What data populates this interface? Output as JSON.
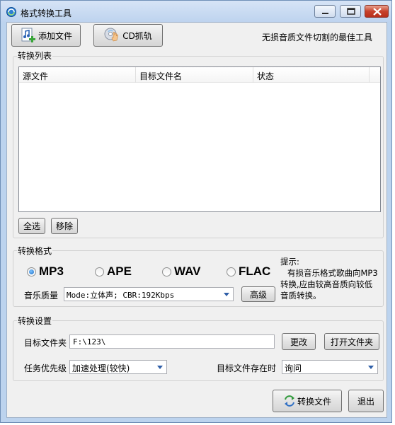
{
  "window": {
    "title": "格式转换工具",
    "colors": {
      "accent": "#1c6fc7",
      "close": "#c7412b",
      "titlebar": "#bcd2ee"
    }
  },
  "toolbar": {
    "add_file_label": "添加文件",
    "add_file_icon": "music-file-add-icon",
    "cd_rip_label": "CD抓轨",
    "cd_rip_icon": "cd-hand-icon",
    "slogan": "无损音质文件切割的最佳工具"
  },
  "list_group": {
    "title": "转换列表",
    "columns": [
      "源文件",
      "目标文件名",
      "状态"
    ],
    "select_all_label": "全选",
    "remove_label": "移除"
  },
  "format_group": {
    "title": "转换格式",
    "options": [
      {
        "label": "MP3",
        "checked": true
      },
      {
        "label": "APE",
        "checked": false
      },
      {
        "label": "WAV",
        "checked": false
      },
      {
        "label": "FLAC",
        "checked": false
      }
    ],
    "quality_label": "音乐质量",
    "quality_value": "Mode:立体声; CBR:192Kbps",
    "advanced_label": "高级",
    "tip_title": "提示:",
    "tip_line1": "有损音乐格式歌曲向MP3",
    "tip_line2": "转换,应由较高音质向较低",
    "tip_line3": "音质转换。"
  },
  "settings_group": {
    "title": "转换设置",
    "target_folder_label": "目标文件夹",
    "target_folder_value": "F:\\123\\",
    "change_label": "更改",
    "open_folder_label": "打开文件夹",
    "priority_label": "任务优先级",
    "priority_value": "加速处理(较快)",
    "exists_label": "目标文件存在时",
    "exists_value": "询问"
  },
  "footer": {
    "convert_label": "转换文件",
    "convert_icon": "convert-arrows-icon",
    "exit_label": "退出"
  }
}
